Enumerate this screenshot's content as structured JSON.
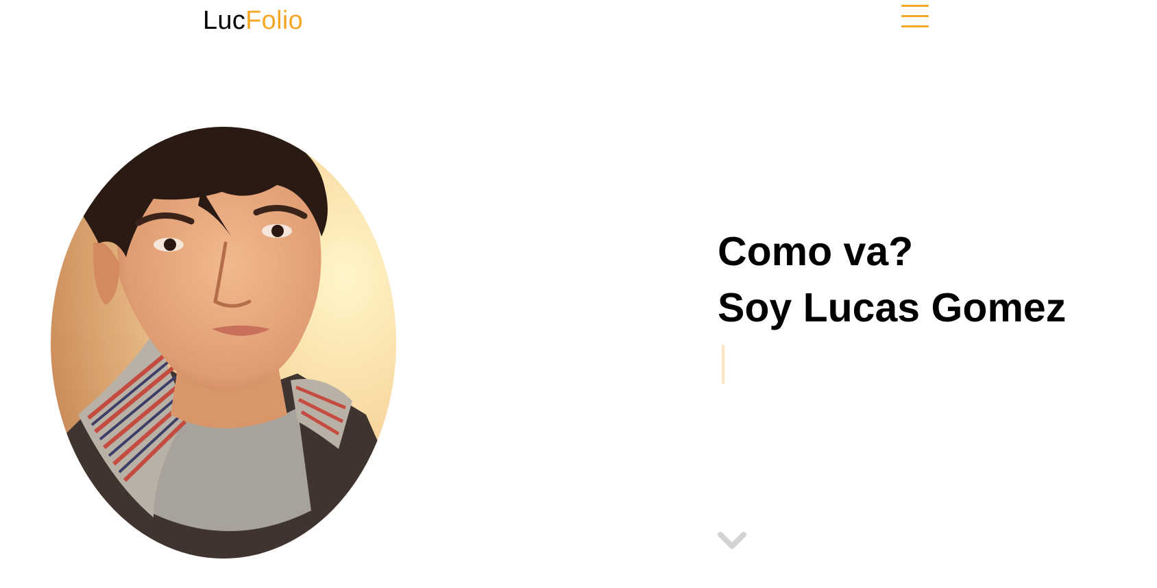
{
  "colors": {
    "accent": "#F5A623",
    "text": "#000000",
    "background": "#FFFFFF",
    "cursor": "#FBE3C4",
    "chevron": "#D3D3D3"
  },
  "header": {
    "brand_prefix": "Luc",
    "brand_suffix": "Folio",
    "menu_icon": "hamburger-menu-icon"
  },
  "hero": {
    "photo_alt": "Lucas Gomez",
    "greeting": "Como va?",
    "intro": "Soy Lucas Gomez",
    "scroll_icon": "chevron-down-icon"
  }
}
